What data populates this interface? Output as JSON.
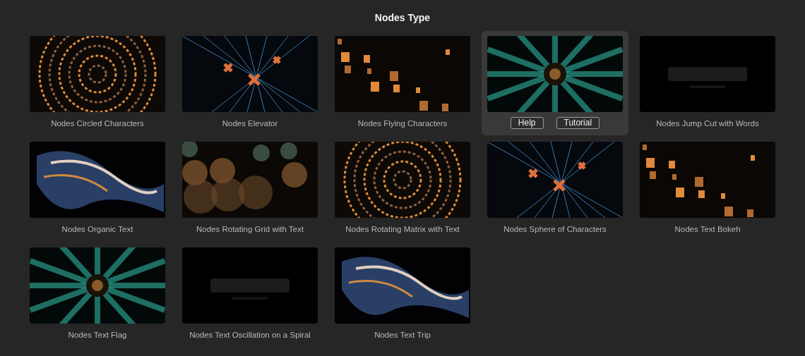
{
  "title": "Nodes Type",
  "templates": [
    {
      "name": "Nodes Circled Characters",
      "selected": false
    },
    {
      "name": "Nodes Elevator",
      "selected": false
    },
    {
      "name": "Nodes Flying Characters",
      "selected": false
    },
    {
      "selected": true,
      "buttons": [
        "Help",
        "Tutorial"
      ]
    },
    {
      "name": "Nodes Jump Cut with Words",
      "selected": false
    },
    {
      "name": "Nodes Organic Text",
      "selected": false
    },
    {
      "name": "Nodes Rotating Grid with Text",
      "selected": false
    },
    {
      "name": "Nodes Rotating Matrix with Text",
      "selected": false
    },
    {
      "name": "Nodes Sphere of Characters",
      "selected": false
    },
    {
      "name": "Nodes Text Bokeh",
      "selected": false
    },
    {
      "name": "Nodes Text Flag",
      "selected": false
    },
    {
      "name": "Nodes Text Oscillation on a Spiral",
      "selected": false
    },
    {
      "name": "Nodes Text Trip",
      "selected": false
    }
  ]
}
